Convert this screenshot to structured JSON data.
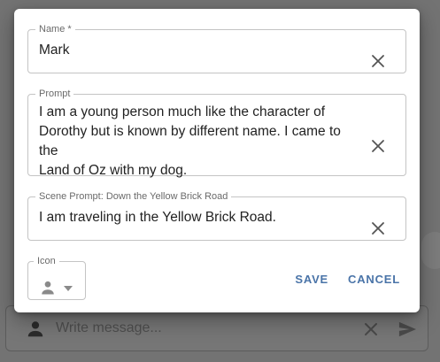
{
  "dialog": {
    "name_field": {
      "label": "Name *",
      "value": "Mark"
    },
    "prompt_field": {
      "label": "Prompt",
      "lines": [
        "I am a young person much like the character of",
        "Dorothy but is known by different name. I came to the",
        "Land of Oz with my dog."
      ]
    },
    "scene_field": {
      "label": "Scene Prompt: Down the Yellow Brick Road",
      "value": "I am traveling in the Yellow Brick Road."
    },
    "icon_select": {
      "label": "Icon",
      "selected_icon": "person-icon"
    },
    "save_label": "SAVE",
    "cancel_label": "CANCEL"
  },
  "message_bar": {
    "placeholder": "Write message..."
  },
  "colors": {
    "accent": "#4a74a8",
    "scrim": "#737373",
    "dialog_bg": "#ffffff",
    "border": "#c4c4c4"
  }
}
